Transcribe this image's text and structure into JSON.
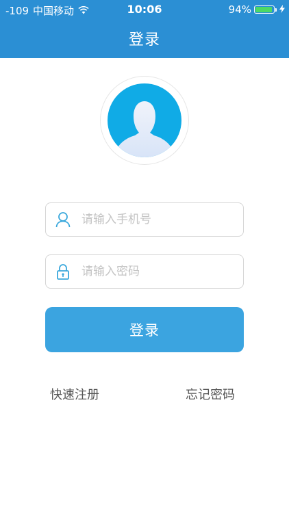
{
  "status_bar": {
    "signal": "-109",
    "carrier": "中国移动",
    "time": "10:06",
    "battery_percent": "94%",
    "battery_level": 0.94
  },
  "nav": {
    "title": "登录"
  },
  "form": {
    "phone_placeholder": "请输入手机号",
    "password_placeholder": "请输入密码",
    "login_label": "登录"
  },
  "links": {
    "register": "快速注册",
    "forgot": "忘记密码"
  },
  "colors": {
    "header": "#2b8fd4",
    "button": "#3ba4e0",
    "icon": "#3aa8dc",
    "avatar_bg": "#10abe6"
  },
  "icons": {
    "phone_field": "user-outline-icon",
    "password_field": "lock-icon",
    "wifi": "wifi-icon",
    "charging": "lightning-icon"
  }
}
